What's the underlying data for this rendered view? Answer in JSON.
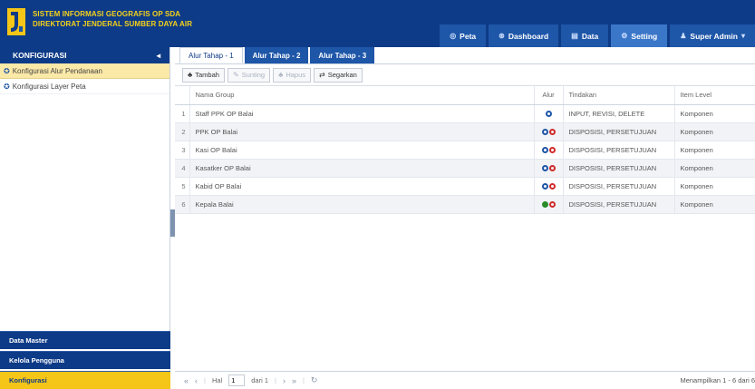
{
  "header": {
    "title_line1": "SISTEM INFORMASI GEOGRAFIS OP SDA",
    "title_line2": "DIREKTORAT JENDERAL SUMBER DAYA AIR",
    "nav": [
      {
        "label": "Peta",
        "icon": "globe-icon"
      },
      {
        "label": "Dashboard",
        "icon": "dashboard-icon"
      },
      {
        "label": "Data",
        "icon": "data-icon"
      },
      {
        "label": "Setting",
        "icon": "settings-icon"
      },
      {
        "label": "Super Admin",
        "icon": "user-icon"
      }
    ]
  },
  "sidebar": {
    "header": "KONFIGURASI",
    "items": [
      {
        "label": "Konfigurasi Alur Pendanaan"
      },
      {
        "label": "Konfigurasi Layer Peta"
      }
    ],
    "bottom": [
      {
        "label": "Data Master"
      },
      {
        "label": "Kelola Pengguna"
      },
      {
        "label": "Konfigurasi"
      }
    ]
  },
  "tabs": [
    "Alur Tahap - 1",
    "Alur Tahap - 2",
    "Alur Tahap - 3"
  ],
  "toolbar": {
    "add": "Tambah",
    "edit": "Sunting",
    "delete": "Hapus",
    "refresh": "Segarkan"
  },
  "table": {
    "columns": [
      "Nama Group",
      "Alur",
      "Tindakan",
      "Item Level"
    ],
    "rows": [
      {
        "no": "1",
        "name": "Staff PPK OP Balai",
        "alur": [
          "blue"
        ],
        "tindakan": "INPUT, REVISI, DELETE",
        "level": "Komponen"
      },
      {
        "no": "2",
        "name": "PPK OP Balai",
        "alur": [
          "blue",
          "red"
        ],
        "tindakan": "DISPOSISI, PERSETUJUAN",
        "level": "Komponen"
      },
      {
        "no": "3",
        "name": "Kasi OP Balai",
        "alur": [
          "blue",
          "red"
        ],
        "tindakan": "DISPOSISI, PERSETUJUAN",
        "level": "Komponen"
      },
      {
        "no": "4",
        "name": "Kasatker OP Balai",
        "alur": [
          "blue",
          "red"
        ],
        "tindakan": "DISPOSISI, PERSETUJUAN",
        "level": "Komponen"
      },
      {
        "no": "5",
        "name": "Kabid OP Balai",
        "alur": [
          "blue",
          "red"
        ],
        "tindakan": "DISPOSISI, PERSETUJUAN",
        "level": "Komponen"
      },
      {
        "no": "6",
        "name": "Kepala Balai",
        "alur": [
          "green",
          "red"
        ],
        "tindakan": "DISPOSISI, PERSETUJUAN",
        "level": "Komponen"
      }
    ]
  },
  "pager": {
    "page_label": "Hal",
    "page_value": "1",
    "of_label": "dari 1",
    "info": "Menampilkan 1 - 6 dari 6"
  },
  "colors": {
    "brand": "#0e3b87",
    "accent": "#f5c518"
  }
}
